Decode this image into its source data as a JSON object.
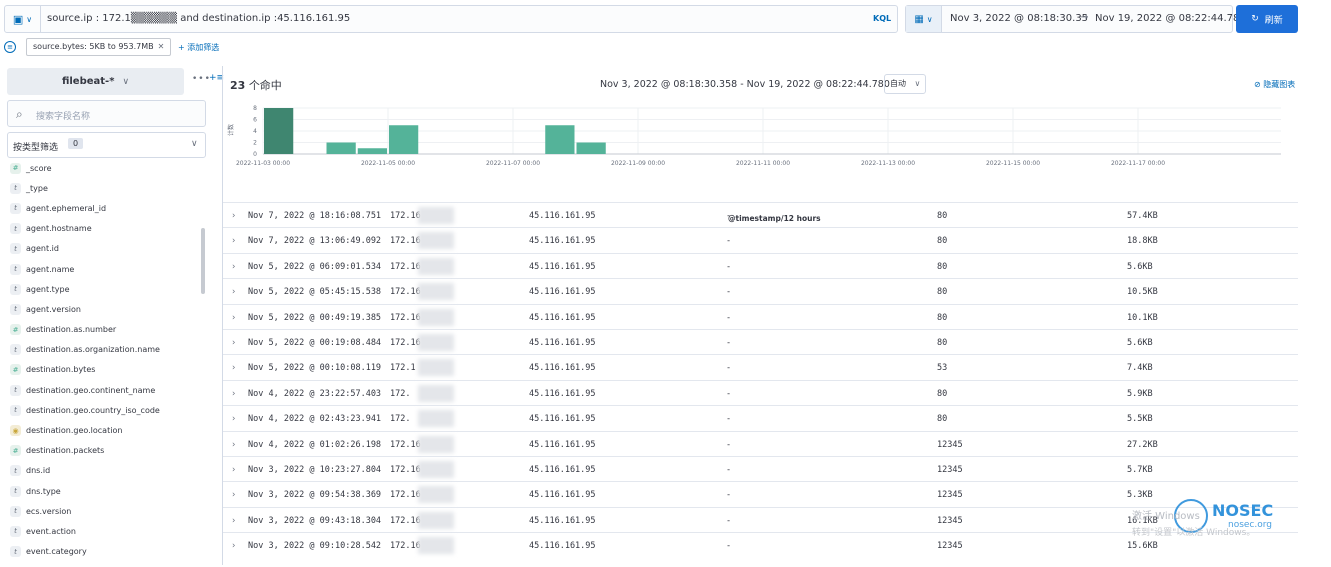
{
  "query": {
    "text": "source.ip : 172.1▒▒▒▒▒▒ and destination.ip :45.116.161.95",
    "language": "KQL"
  },
  "datepicker": {
    "start": "Nov 3, 2022 @ 08:18:30.35",
    "arrow": "→",
    "end": "Nov 19, 2022 @ 08:22:44.78",
    "refresh_label": "刷新"
  },
  "filters": {
    "pill": "source.bytes: 5KB to 953.7MB",
    "add_label": "+ 添加筛选"
  },
  "sidebar": {
    "index_pattern": "filebeat-*",
    "search_placeholder": "搜索字段名称",
    "type_filter_label": "按类型筛选",
    "type_filter_count": "0",
    "fields": [
      {
        "type": "number",
        "token": "#",
        "name": "_score"
      },
      {
        "type": "string",
        "token": "t",
        "name": "_type"
      },
      {
        "type": "string",
        "token": "t",
        "name": "agent.ephemeral_id"
      },
      {
        "type": "string",
        "token": "t",
        "name": "agent.hostname"
      },
      {
        "type": "string",
        "token": "t",
        "name": "agent.id"
      },
      {
        "type": "string",
        "token": "t",
        "name": "agent.name"
      },
      {
        "type": "string",
        "token": "t",
        "name": "agent.type"
      },
      {
        "type": "string",
        "token": "t",
        "name": "agent.version"
      },
      {
        "type": "number",
        "token": "#",
        "name": "destination.as.number"
      },
      {
        "type": "string",
        "token": "t",
        "name": "destination.as.organization.name"
      },
      {
        "type": "number",
        "token": "#",
        "name": "destination.bytes"
      },
      {
        "type": "string",
        "token": "t",
        "name": "destination.geo.continent_name"
      },
      {
        "type": "string",
        "token": "t",
        "name": "destination.geo.country_iso_code"
      },
      {
        "type": "geo",
        "token": "◉",
        "name": "destination.geo.location"
      },
      {
        "type": "number",
        "token": "#",
        "name": "destination.packets"
      },
      {
        "type": "string",
        "token": "t",
        "name": "dns.id"
      },
      {
        "type": "string",
        "token": "t",
        "name": "dns.type"
      },
      {
        "type": "string",
        "token": "t",
        "name": "ecs.version"
      },
      {
        "type": "string",
        "token": "t",
        "name": "event.action"
      },
      {
        "type": "string",
        "token": "t",
        "name": "event.category"
      }
    ]
  },
  "main": {
    "hits_count": "23",
    "hits_suffix": "个命中",
    "range": "Nov 3, 2022 @ 08:18:30.358 - Nov 19, 2022 @ 08:22:44.780",
    "interval": "自动",
    "hide_chart": "隐藏图表"
  },
  "chart_data": {
    "type": "bar",
    "xlabel": "@timestamp/12 hours",
    "ylabel": "计数",
    "ylim": [
      0,
      8
    ],
    "yticks": [
      "8",
      "6",
      "4",
      "2",
      "0"
    ],
    "xtick_labels": [
      "2022-11-03 00:00",
      "2022-11-05 00:00",
      "2022-11-07 00:00",
      "2022-11-09 00:00",
      "2022-11-11 00:00",
      "2022-11-13 00:00",
      "2022-11-15 00:00",
      "2022-11-17 00:00"
    ],
    "bars": [
      {
        "start": "2022-11-03 00:00",
        "value": 8,
        "highlight": true
      },
      {
        "start": "2022-11-04 00:00",
        "value": 2
      },
      {
        "start": "2022-11-04 12:00",
        "value": 1
      },
      {
        "start": "2022-11-05 00:00",
        "value": 5
      },
      {
        "start": "2022-11-07 12:00",
        "value": 5
      },
      {
        "start": "2022-11-08 00:00",
        "value": 2
      }
    ],
    "colors": {
      "bar": "#54b399",
      "highlight": "#3f8670"
    }
  },
  "rows": [
    {
      "time": "Nov 7, 2022 @ 18:16:08.751",
      "src": "172.16",
      "dst": "45.116.161.95",
      "dash": "-",
      "port": "80",
      "bytes": "57.4KB"
    },
    {
      "time": "Nov 7, 2022 @ 13:06:49.092",
      "src": "172.16",
      "dst": "45.116.161.95",
      "dash": "-",
      "port": "80",
      "bytes": "18.8KB"
    },
    {
      "time": "Nov 5, 2022 @ 06:09:01.534",
      "src": "172.16",
      "dst": "45.116.161.95",
      "dash": "-",
      "port": "80",
      "bytes": "5.6KB"
    },
    {
      "time": "Nov 5, 2022 @ 05:45:15.538",
      "src": "172.16",
      "dst": "45.116.161.95",
      "dash": "-",
      "port": "80",
      "bytes": "10.5KB"
    },
    {
      "time": "Nov 5, 2022 @ 00:49:19.385",
      "src": "172.16",
      "dst": "45.116.161.95",
      "dash": "-",
      "port": "80",
      "bytes": "10.1KB"
    },
    {
      "time": "Nov 5, 2022 @ 00:19:08.484",
      "src": "172.16",
      "dst": "45.116.161.95",
      "dash": "-",
      "port": "80",
      "bytes": "5.6KB"
    },
    {
      "time": "Nov 5, 2022 @ 00:10:08.119",
      "src": "172.1",
      "dst": "45.116.161.95",
      "dash": "-",
      "port": "53",
      "bytes": "7.4KB"
    },
    {
      "time": "Nov 4, 2022 @ 23:22:57.403",
      "src": "172.",
      "dst": "45.116.161.95",
      "dash": "-",
      "port": "80",
      "bytes": "5.9KB"
    },
    {
      "time": "Nov 4, 2022 @ 02:43:23.941",
      "src": "172.",
      "dst": "45.116.161.95",
      "dash": "-",
      "port": "80",
      "bytes": "5.5KB"
    },
    {
      "time": "Nov 4, 2022 @ 01:02:26.198",
      "src": "172.16",
      "dst": "45.116.161.95",
      "dash": "-",
      "port": "12345",
      "bytes": "27.2KB"
    },
    {
      "time": "Nov 3, 2022 @ 10:23:27.804",
      "src": "172.16.",
      "dst": "45.116.161.95",
      "dash": "-",
      "port": "12345",
      "bytes": "5.7KB"
    },
    {
      "time": "Nov 3, 2022 @ 09:54:38.369",
      "src": "172.16.",
      "dst": "45.116.161.95",
      "dash": "-",
      "port": "12345",
      "bytes": "5.3KB"
    },
    {
      "time": "Nov 3, 2022 @ 09:43:18.304",
      "src": "172.16.",
      "dst": "45.116.161.95",
      "dash": "-",
      "port": "12345",
      "bytes": "16.1KB"
    },
    {
      "time": "Nov 3, 2022 @ 09:10:28.542",
      "src": "172.16",
      "dst": "45.116.161.95",
      "dash": "-",
      "port": "12345",
      "bytes": "15.6KB"
    }
  ],
  "watermark": {
    "activate": "激活 Windows",
    "sub": "转到\"设置\"以激活 Windows。",
    "brand": "NOSEC",
    "url": "nosec.org"
  }
}
